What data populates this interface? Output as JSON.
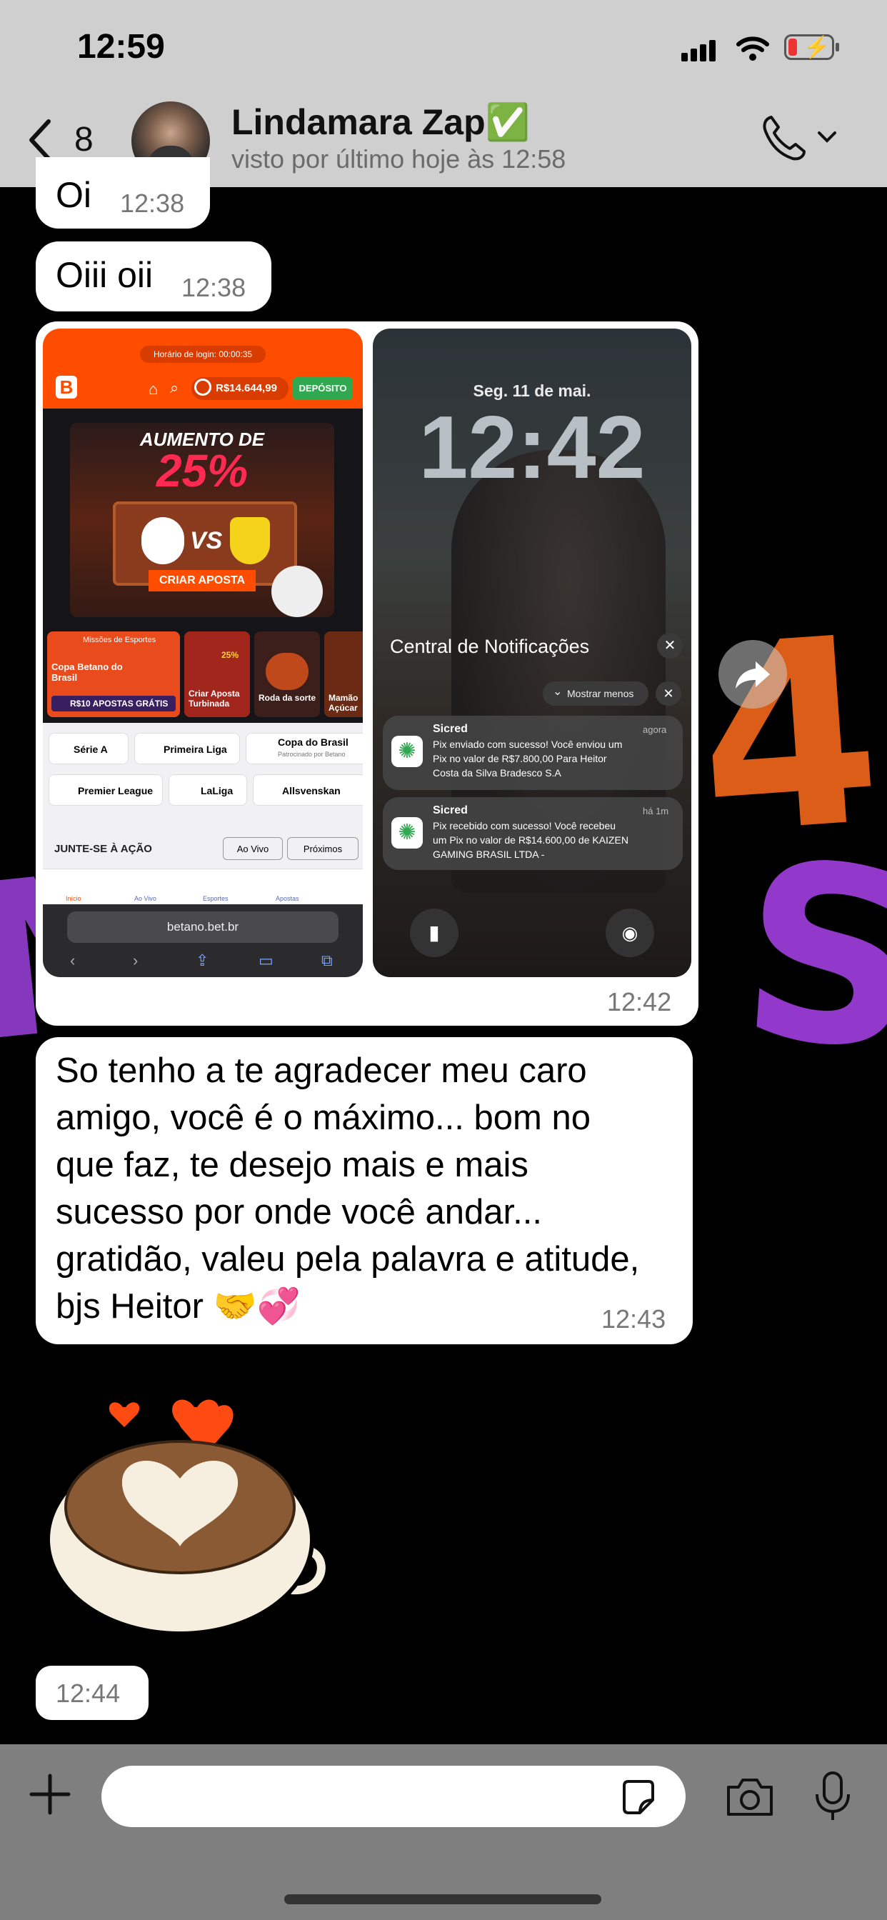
{
  "status": {
    "time": "12:59"
  },
  "header": {
    "back_count": "8",
    "contact_name": "Lindamara Zap✅",
    "last_seen": "visto por último hoje às 12:58"
  },
  "messages": [
    {
      "text": "Oi",
      "time": "12:38"
    },
    {
      "text": "Oiii oii",
      "time": "12:38"
    },
    {
      "time": "12:42"
    },
    {
      "text_lines": [
        "So tenho a te agradecer meu caro",
        "amigo, você é o máximo... bom no",
        "que faz, te desejo mais e mais",
        "sucesso por onde você andar...",
        "gratidão, valeu pela palavra e atitude,",
        "bjs Heitor 🤝💞"
      ],
      "time": "12:43"
    },
    {
      "time": "12:44"
    }
  ],
  "screenshot_left": {
    "login_label": "Horário de login: 00:00:35",
    "balance": "R$14.644,99",
    "deposit": "DEPÓSITO",
    "banner_line1": "AUMENTO DE",
    "banner_line2": "25%",
    "vs": "VS",
    "banner_cta": "CRIAR APOSTA",
    "cards": [
      "Missões de Esportes",
      "Copa Betano do Brasil",
      "R$10 APOSTAS GRÁTIS",
      "Criar Aposta Turbinada",
      "25%",
      "Roda da sorte",
      "Mamão Açúcar"
    ],
    "leagues_row1": [
      "Série A",
      "Primeira Liga",
      "Copa do Brasil",
      "Patrocinado por Betano"
    ],
    "leagues_row2": [
      "Premier League",
      "LaLiga",
      "Allsvenskan"
    ],
    "section": "JUNTE-SE À AÇÃO",
    "ao_vivo": "Ao Vivo",
    "proximos": "Próximos",
    "nav": [
      "Início",
      "Ao Vivo",
      "Esportes",
      "Apostas"
    ],
    "url": "betano.bet.br"
  },
  "screenshot_right": {
    "date": "Seg. 11 de mai.",
    "clock": "12:42",
    "notif_center": "Central de Notificações",
    "show_less": "Mostrar menos",
    "notifs": [
      {
        "app": "Sicred",
        "when": "agora",
        "lines": [
          "Pix enviado com sucesso! Você enviou um",
          "Pix no valor de R$7.800,00 Para Heitor",
          "Costa da Silva Bradesco S.A"
        ]
      },
      {
        "app": "Sicred",
        "when": "há 1m",
        "lines": [
          "Pix recebido com sucesso! Você recebeu",
          "um Pix no valor de R$14.600,00 de KAIZEN",
          "GAMING BRASIL LTDA -"
        ]
      }
    ]
  },
  "colors": {
    "accent_orange": "#ff4d00",
    "deposit_green": "#2fa84f",
    "chrome_gray": "#cfcfcf"
  }
}
